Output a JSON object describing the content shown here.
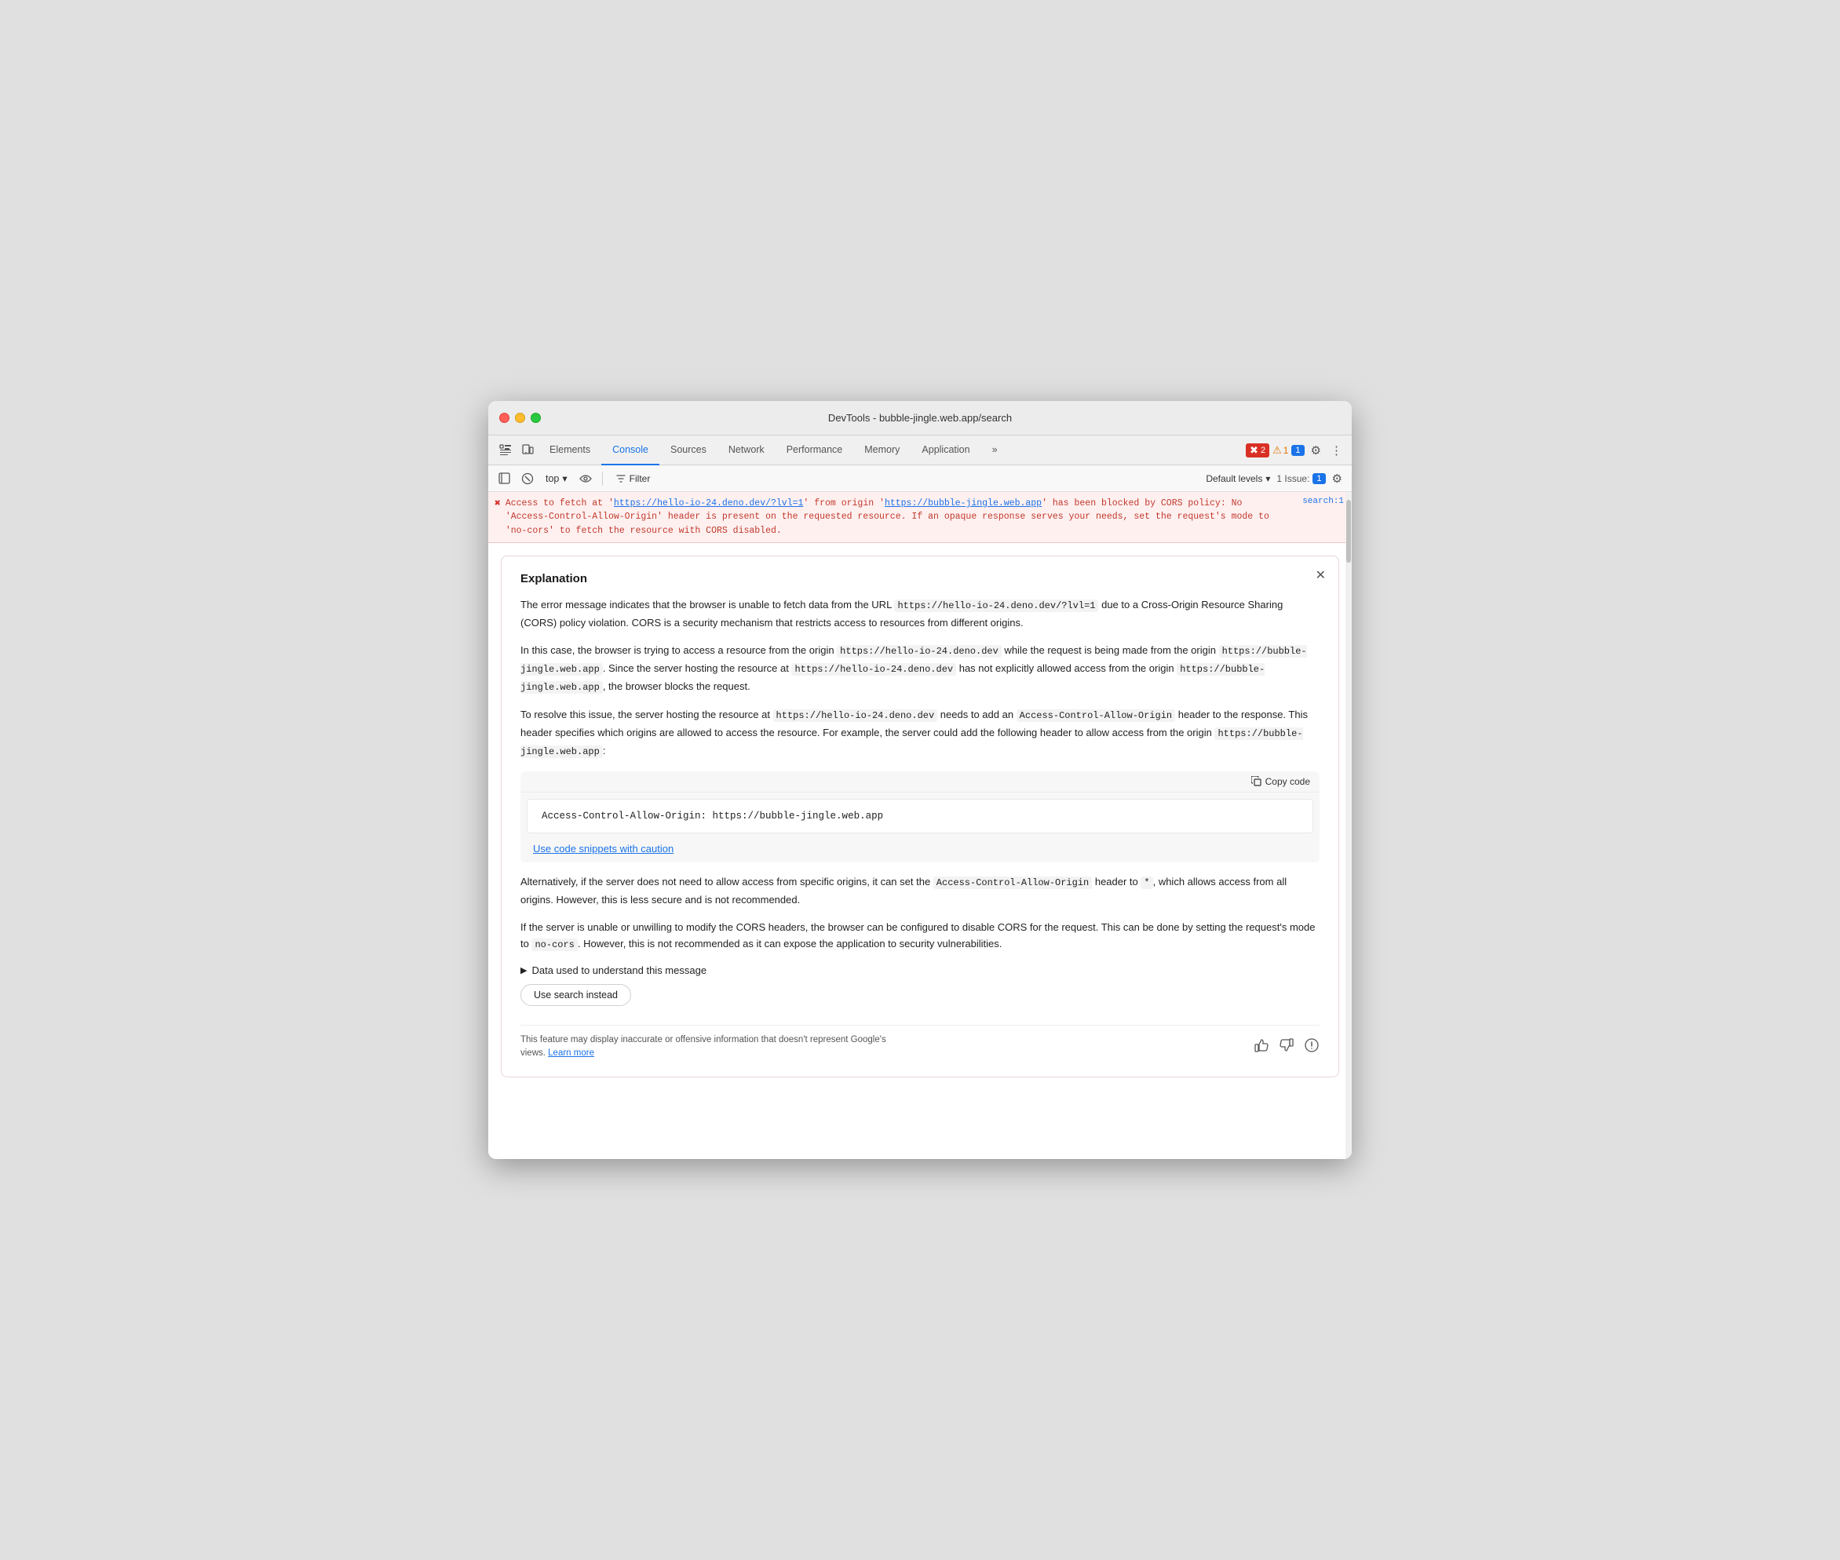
{
  "window": {
    "title": "DevTools - bubble-jingle.web.app/search"
  },
  "tabs": {
    "items": [
      {
        "label": "Elements",
        "active": false
      },
      {
        "label": "Console",
        "active": true
      },
      {
        "label": "Sources",
        "active": false
      },
      {
        "label": "Network",
        "active": false
      },
      {
        "label": "Performance",
        "active": false
      },
      {
        "label": "Memory",
        "active": false
      },
      {
        "label": "Application",
        "active": false
      }
    ],
    "more_label": "»"
  },
  "badges": {
    "errors": "2",
    "warnings": "1",
    "issues": "1",
    "issues_label": "1 Issue:"
  },
  "console_toolbar": {
    "context": "top",
    "filter_placeholder": "Filter",
    "levels_label": "Default levels",
    "issues_label": "1 Issue:"
  },
  "error_row": {
    "text_before": "Access to fetch at '",
    "url1": "https://hello-io-24.deno.dev/?lvl=1",
    "text_middle": "' from origin '",
    "url2": "https://bubble-jingle.web.app",
    "text_after": "' has been blocked by CORS policy: No 'Access-Control-Allow-Origin' header is present on the requested resource. If an opaque response serves your needs, set the request's mode to 'no-cors' to fetch the resource with CORS disabled.",
    "source": "search:1"
  },
  "explanation": {
    "title": "Explanation",
    "para1": "The error message indicates that the browser is unable to fetch data from the URL ",
    "url_inline1": "https://hello-io-24.deno.dev/?lvl=1",
    "para1b": " due to a Cross-Origin Resource Sharing (CORS) policy violation. CORS is a security mechanism that restricts access to resources from different origins.",
    "para2": "In this case, the browser is trying to access a resource from the origin ",
    "code1": "https://hello-io-24.deno.dev",
    "para2b": " while the request is being made from the origin ",
    "code2": "https://bubble-jingle.web.app",
    "para2c": ". Since the server hosting the resource at ",
    "code3": "https://hello-io-24.deno.dev",
    "para2d": " has not explicitly allowed access from the origin ",
    "code4": "https://bubble-jingle.web.app",
    "para2e": ", the browser blocks the request.",
    "para3": "To resolve this issue, the server hosting the resource at ",
    "code5": "https://hello-io-24.deno.dev",
    "para3b": " needs to add an ",
    "code6": "Access-Control-Allow-Origin",
    "para3c": " header to the response. This header specifies which origins are allowed to access the resource. For example, the server could add the following header to allow access from the origin ",
    "code7": "https://bubble-jingle.web.app",
    "para3d": ":",
    "code_snippet": "Access-Control-Allow-Origin: https://bubble-jingle.web.app",
    "copy_label": "Copy code",
    "caution_label": "Use code snippets with caution",
    "para4": "Alternatively, if the server does not need to allow access from specific origins, it can set the ",
    "code8": "Access-Control-Allow-Origin",
    "para4b": " header to ",
    "code9": "*",
    "para4c": ", which allows access from all origins. However, this is less secure and is not recommended.",
    "para5": "If the server is unable or unwilling to modify the CORS headers, the browser can be configured to disable CORS for the request. This can be done by setting the request's mode to ",
    "code10": "no-cors",
    "para5b": ". However, this is not recommended as it can expose the application to security vulnerabilities.",
    "data_used_label": "Data used to understand this message",
    "search_instead_label": "Use search instead",
    "disclaimer": "This feature may display inaccurate or offensive information that doesn't represent Google's views.",
    "learn_more": "Learn more"
  }
}
